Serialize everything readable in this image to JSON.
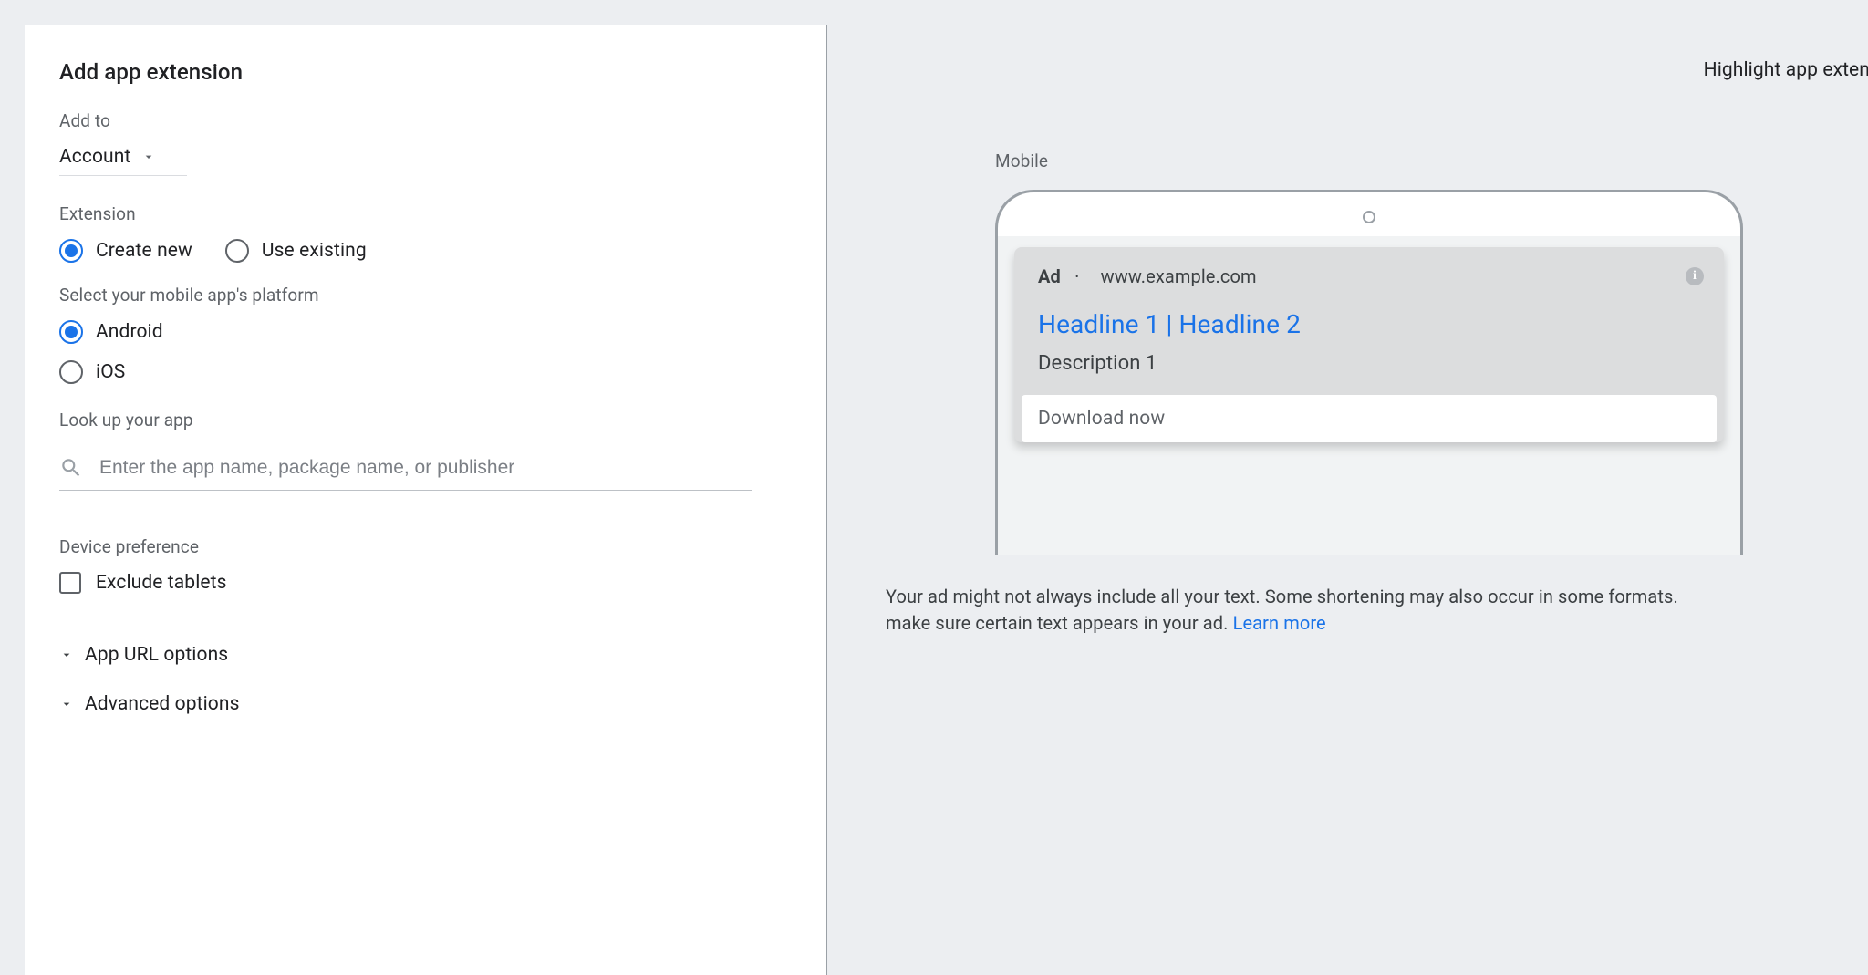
{
  "page": {
    "title": "Add app extension",
    "addTo": {
      "label": "Add to",
      "value": "Account"
    }
  },
  "extension": {
    "label": "Extension",
    "createNew": "Create new",
    "useExisting": "Use existing"
  },
  "platform": {
    "label": "Select your mobile app's platform",
    "android": "Android",
    "ios": "iOS"
  },
  "lookup": {
    "label": "Look up your app",
    "placeholder": "Enter the app name, package name, or publisher"
  },
  "device": {
    "label": "Device preference",
    "exclude": "Exclude tablets"
  },
  "collapsibles": {
    "appUrl": "App URL options",
    "advanced": "Advanced options"
  },
  "topRight": "Highlight app exten",
  "preview": {
    "label": "Mobile",
    "ad": {
      "badge": "Ad",
      "separator": "·",
      "url": "www.example.com",
      "headline": "Headline 1 | Headline 2",
      "description": "Description 1",
      "cta": "Download now"
    },
    "disclaimer1": "Your ad might not always include all your text. Some shortening may also occur in some formats.",
    "disclaimer2": "make sure certain text appears in your ad.",
    "learnMore": "Learn more"
  }
}
